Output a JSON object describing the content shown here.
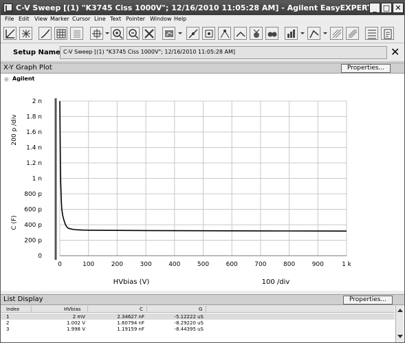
{
  "window": {
    "title": "C-V Sweep [(1) \"K3745 Ciss 1000V\"; 12/16/2010 11:05:28 AM] - Agilent EasyEXPERT",
    "minimize": "_",
    "maximize": "□",
    "close": "✕"
  },
  "menu": [
    "File",
    "Edit",
    "View",
    "Marker",
    "Cursor",
    "Line",
    "Text",
    "Pointer",
    "Window",
    "Help"
  ],
  "toolbar": {
    "icons": [
      "autoscale-icon",
      "grid-icon",
      "curve-icon",
      "table-icon",
      "list-icon",
      "crosshair-icon",
      "zoom-in-icon",
      "zoom-out-icon",
      "tools-icon",
      "data-icon",
      "line-fit-icon",
      "marker-icon",
      "cursor-icon",
      "tangent-icon",
      "regression-icon",
      "binocular-icon",
      "bar-icon",
      "scale-icon",
      "gradient-icon",
      "gradient-alt-icon",
      "grid-view-icon",
      "clipboard-icon"
    ]
  },
  "setup": {
    "label": "Setup Name:",
    "value": "C-V Sweep [(1) \"K3745 Ciss 1000V\"; 12/16/2010 11:05:28 AM]",
    "close": "✕"
  },
  "graph_panel": {
    "title": "X-Y Graph Plot",
    "properties": "Properties...",
    "logo": "Agilent"
  },
  "list_panel": {
    "title": "List Display",
    "properties": "Properties...",
    "columns": [
      "Index",
      "HVbias",
      "C",
      "G"
    ],
    "rows": [
      [
        "1",
        "2 mV",
        "2.34627 nF",
        "-5.12222 uS"
      ],
      [
        "2",
        "1.002 V",
        "1.60794 nF",
        "-8.29220 uS"
      ],
      [
        "3",
        "1.998 V",
        "1.19159 nF",
        "-8.44395 uS"
      ]
    ]
  },
  "chart_data": {
    "type": "line",
    "xlabel": "HVbias (V)",
    "ylabel": "C (F)",
    "x_div_label": "100  /div",
    "y_div_label": "200 p /div",
    "xlim": [
      0,
      1000
    ],
    "ylim": [
      0,
      2.0
    ],
    "y_unit": "nF",
    "x_ticks": [
      "0",
      "100",
      "200",
      "300",
      "400",
      "500",
      "600",
      "700",
      "800",
      "900",
      "1 k"
    ],
    "y_ticks": [
      "0",
      "200 p",
      "400 p",
      "600 p",
      "800 p",
      "1 n",
      "1.2 n",
      "1.4 n",
      "1.6 n",
      "1.8 n",
      "2 n"
    ],
    "grid": true,
    "series": [
      {
        "x": [
          0,
          1,
          2,
          3,
          5,
          7,
          10,
          15,
          20,
          25,
          30,
          40,
          50,
          60,
          80,
          100,
          150,
          200,
          300,
          400,
          500,
          600,
          700,
          800,
          900,
          1000
        ],
        "y": [
          2.35,
          1.61,
          1.19,
          0.95,
          0.72,
          0.6,
          0.52,
          0.45,
          0.4,
          0.37,
          0.355,
          0.345,
          0.338,
          0.335,
          0.332,
          0.33,
          0.328,
          0.327,
          0.325,
          0.324,
          0.323,
          0.322,
          0.321,
          0.32,
          0.319,
          0.318
        ]
      }
    ]
  },
  "colors": {
    "titlebar": "#3a3a3a",
    "grid": "#c8c8c8",
    "curve": "#000000"
  }
}
